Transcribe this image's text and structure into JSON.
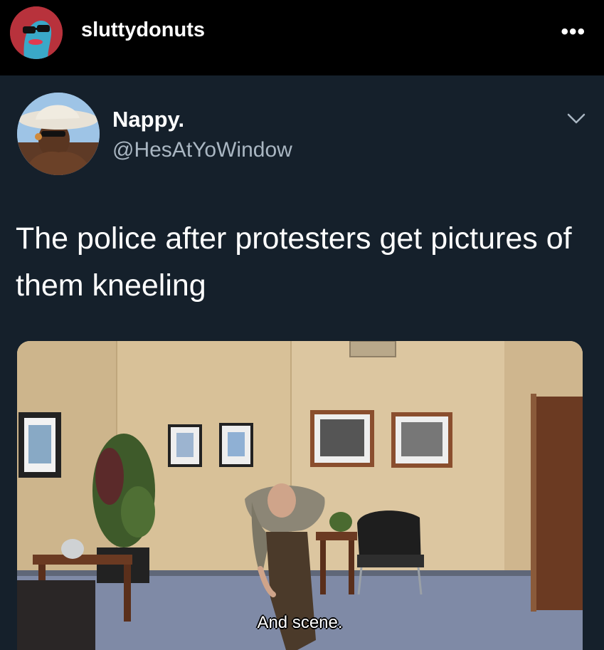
{
  "instagram_header": {
    "username": "sluttydonuts",
    "more_label": "•••"
  },
  "tweet": {
    "display_name": "Nappy.",
    "handle": "@HesAtYoWindow",
    "text": "The police after protesters get pictures of them kneeling",
    "media": {
      "caption": "And scene."
    }
  },
  "colors": {
    "header_bg": "#000000",
    "tweet_bg": "#15202b",
    "handle_text": "#a9b6c2",
    "text": "#ffffff"
  },
  "icons": {
    "more": "more-dots-icon",
    "expand": "chevron-down-icon"
  }
}
